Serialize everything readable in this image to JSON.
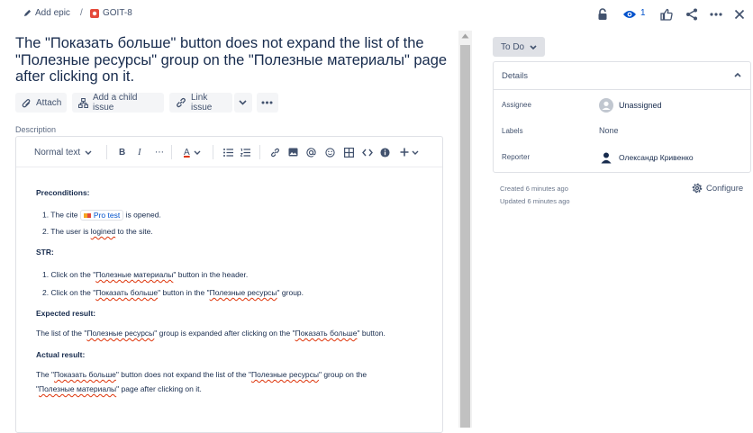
{
  "breadcrumb": {
    "add_epic": "Add epic",
    "separator": "/",
    "issue_key": "GOIT-8"
  },
  "header": {
    "watch_count": "1"
  },
  "issue": {
    "title": "The \"Показать больше\" button does not expand the list of the \"Полезные ресурсы\" group on the \"Полезные материалы\" page after clicking on it."
  },
  "actions": {
    "attach": "Attach",
    "add_child": "Add a child issue",
    "link_issue": "Link issue"
  },
  "description": {
    "label": "Description",
    "toolbar": {
      "text_style": "Normal text",
      "bold": "B",
      "italic": "I",
      "more": "⋯",
      "color": "A"
    },
    "preconditions_heading": "Preconditions:",
    "pre1_a": "The cite",
    "pre1_chip": "Pro test",
    "pre1_b": "is opened.",
    "pre2_a": "The user is",
    "pre2_sq": "logined",
    "pre2_b": "to the site.",
    "str_heading": "STR:",
    "str1_a": "Click on the \"",
    "str1_sq": "Полезные материалы",
    "str1_b": "\" button in the header.",
    "str2_a": "Click on the \"",
    "str2_sq1": "Показать больше",
    "str2_b": "\" button in the \"",
    "str2_sq2": "Полезные ресурсы",
    "str2_c": "\" group.",
    "expected_heading": "Expected result:",
    "exp_a": "The list of the \"",
    "exp_sq1": "Полезные ресурсы",
    "exp_b": "\" group is expanded after clicking on the \"",
    "exp_sq2": "Показать больше",
    "exp_c": "\" button.",
    "actual_heading": "Actual result:",
    "act_a": "The \"",
    "act_sq1": "Показать больше",
    "act_b": "\" button does not expand the list of the \"",
    "act_sq2": "Полезные ресурсы",
    "act_c": "\" group on the",
    "act_d": "\"",
    "act_sq3": "Полезные материалы",
    "act_e": "\" page after clicking on it."
  },
  "sidebar": {
    "status": "To Do",
    "details_title": "Details",
    "assignee_label": "Assignee",
    "assignee_value": "Unassigned",
    "labels_label": "Labels",
    "labels_value": "None",
    "reporter_label": "Reporter",
    "reporter_value": "Олександр Кривенко",
    "created": "Created 6 minutes ago",
    "updated": "Updated 6 minutes ago",
    "configure": "Configure"
  },
  "colors": {
    "issue_type_bug": "#e5493a",
    "link_blue": "#0052cc",
    "text_primary": "#172b4d"
  }
}
